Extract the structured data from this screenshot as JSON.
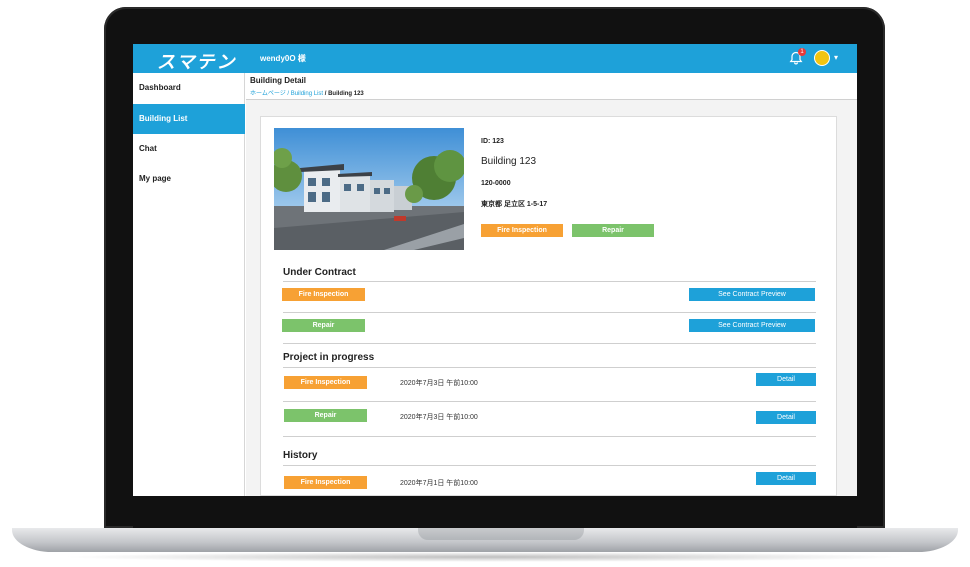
{
  "app": {
    "logo": "スマテン",
    "user": "wendy0O 様",
    "notification_count": "1"
  },
  "sidebar": {
    "items": [
      {
        "label": "Dashboard"
      },
      {
        "label": "Building List"
      },
      {
        "label": "Chat"
      },
      {
        "label": "My page"
      }
    ],
    "active_index": 1
  },
  "header": {
    "title": "Building Detail",
    "breadcrumb": {
      "home": "ホームページ",
      "sep1": " / ",
      "list": "Building List",
      "sep2": " / ",
      "current": "Building 123"
    }
  },
  "building": {
    "id": "ID: 123",
    "name": "Building 123",
    "postal": "120-0000",
    "address": "東京都 足立区 1-5-17",
    "tags": [
      "Fire Inspection",
      "Repair"
    ]
  },
  "under_contract": {
    "title": "Under Contract",
    "rows": [
      {
        "tag": "Fire Inspection",
        "action": "See Contract Preview"
      },
      {
        "tag": "Repair",
        "action": "See Contract Preview"
      }
    ]
  },
  "in_progress": {
    "title": "Project in progress",
    "rows": [
      {
        "tag": "Fire Inspection",
        "date": "2020年7月3日 午前10:00",
        "action": "Detail"
      },
      {
        "tag": "Repair",
        "date": "2020年7月3日 午前10:00",
        "action": "Detail"
      }
    ]
  },
  "history": {
    "title": "History",
    "rows": [
      {
        "tag": "Fire Inspection",
        "date": "2020年7月1日 午前10:00",
        "action": "Detail"
      }
    ]
  },
  "colors": {
    "accent": "#1ea1d9",
    "orange": "#f7a134",
    "green": "#7cc36b"
  },
  "icons": [
    "bell-icon",
    "avatar",
    "chevron-down-icon"
  ]
}
